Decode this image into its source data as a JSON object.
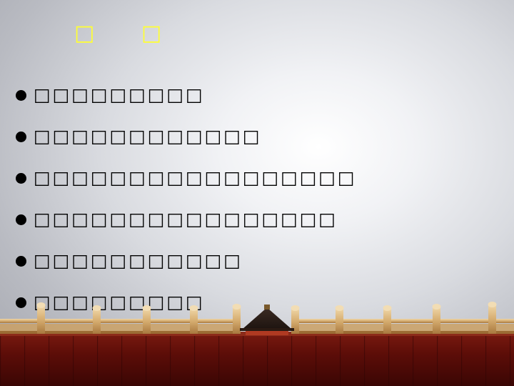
{
  "slide": {
    "title": "□ □",
    "bullets": [
      "□□□□□□□□□",
      "□□□□□□□□□□□□",
      "□□□□□□□□□□□□□□□□□",
      "□□□□□□□□□□□□□□□□",
      "□□□□□□□□□□□",
      "□□□□□□□□□"
    ]
  },
  "colors": {
    "title": "#ffff33",
    "text": "#000000",
    "floor": "#6b0f0a",
    "balustrade": "#d8b27a"
  },
  "icons": {
    "bullet": "filled-circle-bullet",
    "scene": "temple-balustrade-illustration"
  }
}
